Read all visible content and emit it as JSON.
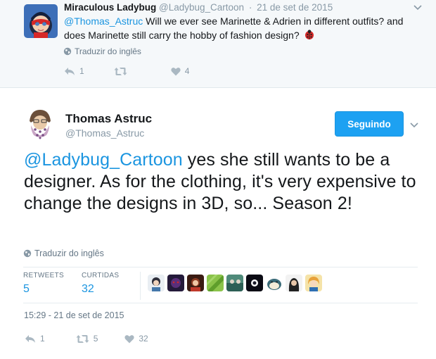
{
  "parent_tweet": {
    "author_name": "Miraculous Ladybug",
    "author_handle": "@Ladybug_Cartoon",
    "separator": "·",
    "date": "21 de set de 2015",
    "mention": "@Thomas_Astruc",
    "text_rest": " Will we ever see Marinette & Adrien in different outfits? and does Marinette still carry the hobby of fashion design?",
    "translate_label": "Traduzir do inglês",
    "reply_count": "1",
    "retweet_count": "",
    "like_count": "4"
  },
  "main_tweet": {
    "author_name": "Thomas Astruc",
    "author_handle": "@Thomas_Astruc",
    "follow_label": "Seguindo",
    "mention": "@Ladybug_Cartoon",
    "text_rest": " yes she still wants to be a designer. As for the clothing, it's very expensive to change the designs in 3D, so... Season 2!",
    "translate_label": "Traduzir do inglês",
    "stats": {
      "retweets_label": "RETWEETS",
      "retweets_value": "5",
      "likes_label": "CURTIDAS",
      "likes_value": "32"
    },
    "timestamp": "15:29 - 21 de set de 2015",
    "reply_count": "1",
    "retweet_count": "5",
    "like_count": "32"
  },
  "colors": {
    "accent": "#1da1f2",
    "link": "#1b95e0",
    "muted": "#8899a6",
    "parent_bg": "#f5f8fa"
  },
  "icons": {
    "globe": "globe-icon",
    "reply": "reply-icon",
    "retweet": "retweet-icon",
    "like": "heart-icon",
    "more": "chevron-down-icon",
    "emoji": "ladybug-emoji-icon"
  }
}
